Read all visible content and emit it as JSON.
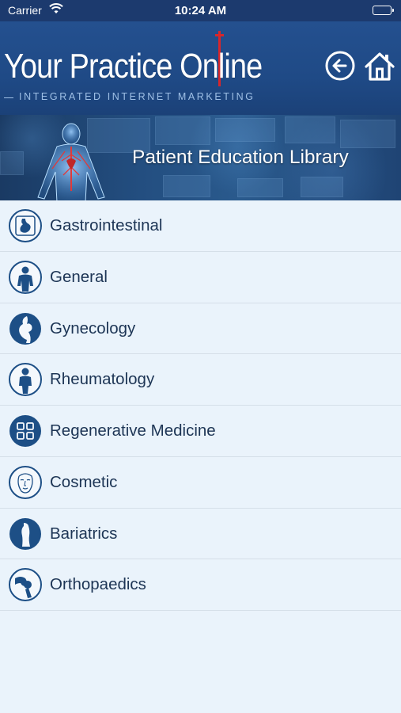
{
  "status_bar": {
    "carrier": "Carrier",
    "time": "10:24 AM"
  },
  "header": {
    "logo_title": "Your Practice Online",
    "logo_subtitle": "INTEGRATED INTERNET MARKETING",
    "back_icon": "back-arrow-icon",
    "home_icon": "home-icon"
  },
  "banner": {
    "title": "Patient Education Library"
  },
  "categories": [
    {
      "label": "Gastrointestinal",
      "icon": "stomach-icon"
    },
    {
      "label": "General",
      "icon": "person-icon"
    },
    {
      "label": "Gynecology",
      "icon": "pregnancy-icon"
    },
    {
      "label": "Rheumatology",
      "icon": "body-figure-icon"
    },
    {
      "label": "Regenerative Medicine",
      "icon": "grid-cells-icon"
    },
    {
      "label": "Cosmetic",
      "icon": "face-icon"
    },
    {
      "label": "Bariatrics",
      "icon": "torso-icon"
    },
    {
      "label": "Orthopaedics",
      "icon": "joint-icon"
    }
  ],
  "colors": {
    "header_blue": "#1f4a86",
    "accent_red": "#d8262b",
    "list_background": "#eaf3fb",
    "label_text": "#1d3555",
    "icon_blue": "#1d4f86"
  }
}
